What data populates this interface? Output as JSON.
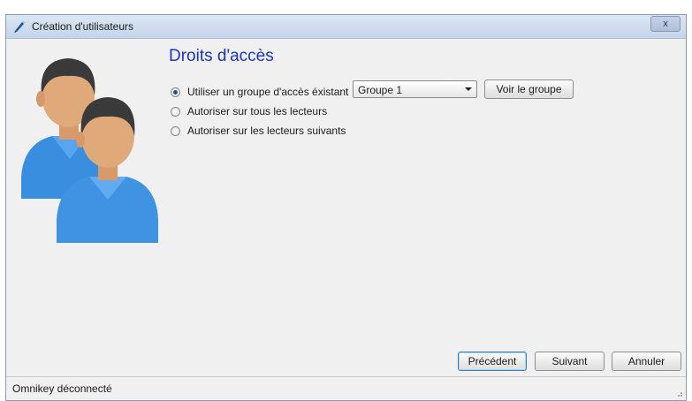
{
  "window": {
    "title": "Création d'utilisateurs",
    "close_label": "x"
  },
  "main": {
    "section_title": "Droits d'accès",
    "options": [
      {
        "label": "Utiliser un groupe d'accès éxistant",
        "checked": true
      },
      {
        "label": "Autoriser sur tous les lecteurs",
        "checked": false
      },
      {
        "label": "Autoriser sur les lecteurs suivants",
        "checked": false
      }
    ],
    "group_select": {
      "value": "Groupe 1"
    },
    "view_group_label": "Voir le groupe"
  },
  "buttons": {
    "previous": "Précédent",
    "next": "Suivant",
    "cancel": "Annuler"
  },
  "status": {
    "text": "Omnikey déconnecté"
  },
  "colors": {
    "title_blue": "#1c34c8",
    "figure_blue": "#3a8ee0",
    "hair": "#3a3a3a",
    "skin": "#e0a97a"
  }
}
